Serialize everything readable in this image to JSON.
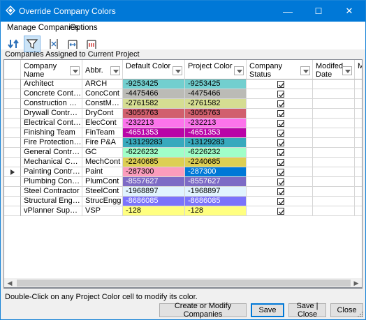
{
  "window": {
    "title": "Override Company Colors",
    "minimize": "—",
    "maximize": "☐",
    "close": "✕"
  },
  "menu": {
    "items": [
      "Manage Companies",
      "Options"
    ]
  },
  "toolbar": {
    "icons": [
      "refresh-icon",
      "filter-icon",
      "column-fit-icon",
      "column-expand-icon",
      "column-reset-icon"
    ],
    "active": "filter-icon"
  },
  "section_label": "Companies Assigned to Current Project",
  "columns": [
    {
      "label": "Company Name",
      "filter": true
    },
    {
      "label": "Abbr.",
      "filter": true
    },
    {
      "label": "Default Color",
      "filter": true
    },
    {
      "label": "Project Color",
      "filter": true
    },
    {
      "label": "Company Status",
      "filter": true
    },
    {
      "label": "Modifed Date",
      "filter": true
    },
    {
      "label": "Mo By",
      "filter": false
    }
  ],
  "rows": [
    {
      "name": "Architect",
      "abbr": "ARCH",
      "default": "-9253425",
      "default_bg": "#72cfcf",
      "project": "-9253425",
      "project_bg": "#72cfcf",
      "status": true,
      "current": false
    },
    {
      "name": "Concrete Contractor",
      "abbr": "ConcCont",
      "default": "-4475466",
      "default_bg": "#bbbbb6",
      "project": "-4475466",
      "project_bg": "#bbbbb6",
      "status": true,
      "current": false
    },
    {
      "name": "Construction Management",
      "abbr": "ConstMgmt",
      "default": "-2761582",
      "default_bg": "#d5dd92",
      "project": "-2761582",
      "project_bg": "#d5dd92",
      "status": true,
      "current": false
    },
    {
      "name": "Drywall Contractor",
      "abbr": "DryCont",
      "default": "-3055763",
      "default_bg": "#d15f6d",
      "project": "-3055763",
      "project_bg": "#d15f6d",
      "status": true,
      "current": false
    },
    {
      "name": "Electrical Contractor",
      "abbr": "ElecCont",
      "default": "-232213",
      "default_bg": "#fc74eb",
      "project": "-232213",
      "project_bg": "#fc74eb",
      "status": true,
      "current": false
    },
    {
      "name": "Finishing Team",
      "abbr": "FinTeam",
      "default": "-4651353",
      "default_bg": "#b904a7",
      "project": "-4651353",
      "project_bg": "#b904a7",
      "status": true,
      "current": false
    },
    {
      "name": "Fire Protection & Alarm",
      "abbr": "Fire P&A",
      "default": "-13129283",
      "default_bg": "#37a9bd",
      "project": "-13129283",
      "project_bg": "#37a9bd",
      "status": true,
      "current": false
    },
    {
      "name": "General Contractor",
      "abbr": "GC",
      "default": "-6226232",
      "default_bg": "#a0fec8",
      "project": "-6226232",
      "project_bg": "#a0fec8",
      "status": true,
      "current": false
    },
    {
      "name": "Mechanical Contractor",
      "abbr": "MechCont",
      "default": "-2240685",
      "default_bg": "#ddcf53",
      "project": "-2240685",
      "project_bg": "#ddcf53",
      "status": true,
      "current": false
    },
    {
      "name": "Painting Contractor",
      "abbr": "Paint",
      "default": "-287300",
      "default_bg": "#fb9cbc",
      "project": "-287300",
      "project_bg": "#0078d7",
      "status": true,
      "current": true
    },
    {
      "name": "Plumbing Contractor",
      "abbr": "PlumCont",
      "default": "-8557627",
      "default_bg": "#7d6bc5",
      "project": "-8557627",
      "project_bg": "#7d6bc5",
      "status": true,
      "current": false
    },
    {
      "name": "Steel Contractor",
      "abbr": "SteelCont",
      "default": "-1968897",
      "default_bg": "#e1f4ff",
      "project": "-1968897",
      "project_bg": "#e1f4ff",
      "status": true,
      "current": false
    },
    {
      "name": "Structural Engineer",
      "abbr": "StrucEngg",
      "default": "-8686085",
      "default_bg": "#7b73fb",
      "project": "-8686085",
      "project_bg": "#7b73fb",
      "status": true,
      "current": false
    },
    {
      "name": "vPlanner Support",
      "abbr": "VSP",
      "default": "-128",
      "default_bg": "#ffff80",
      "project": "-128",
      "project_bg": "#ffff80",
      "status": true,
      "current": false
    }
  ],
  "status_text": "Double-Click on any Project Color cell to modify its color.",
  "buttons": {
    "create": "Create or Modify Companies",
    "save": "Save",
    "save_close": "Save | Close",
    "close": "Close"
  }
}
